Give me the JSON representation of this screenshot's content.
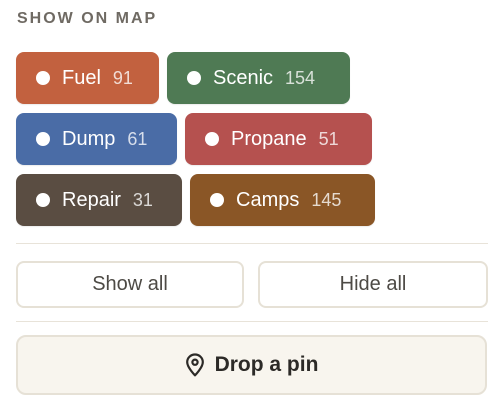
{
  "panel": {
    "heading": "SHOW ON MAP"
  },
  "chips": [
    {
      "label": "Fuel",
      "count": "91",
      "color": "#c2613f"
    },
    {
      "label": "Scenic",
      "count": "154",
      "color": "#4f7a54"
    },
    {
      "label": "Dump",
      "count": "61",
      "color": "#4a6ca6"
    },
    {
      "label": "Propane",
      "count": "51",
      "color": "#b5514f"
    },
    {
      "label": "Repair",
      "count": "31",
      "color": "#5a4d42"
    },
    {
      "label": "Camps",
      "count": "145",
      "color": "#8a5626"
    }
  ],
  "actions": {
    "show_all": "Show all",
    "hide_all": "Hide all"
  },
  "pin": {
    "label": "Drop a pin",
    "icon": "map-pin-icon"
  }
}
